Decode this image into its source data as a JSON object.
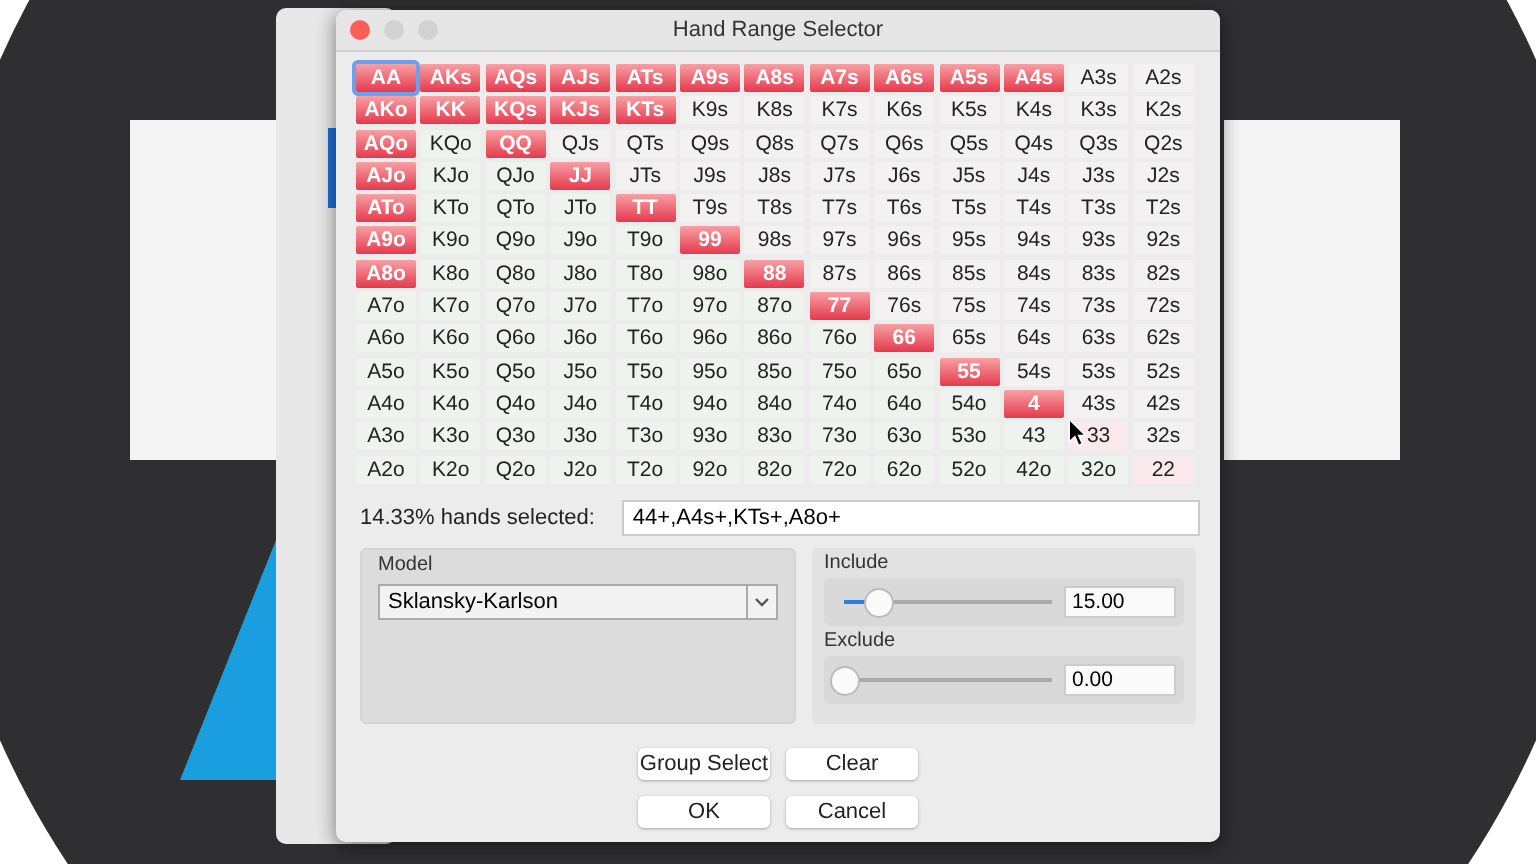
{
  "window": {
    "title": "Hand Range Selector"
  },
  "grid": [
    [
      {
        "label": "AA",
        "selected": true,
        "focused": true
      },
      {
        "label": "AKs",
        "selected": true
      },
      {
        "label": "AQs",
        "selected": true
      },
      {
        "label": "AJs",
        "selected": true
      },
      {
        "label": "ATs",
        "selected": true
      },
      {
        "label": "A9s",
        "selected": true
      },
      {
        "label": "A8s",
        "selected": true
      },
      {
        "label": "A7s",
        "selected": true
      },
      {
        "label": "A6s",
        "selected": true
      },
      {
        "label": "A5s",
        "selected": true
      },
      {
        "label": "A4s",
        "selected": true
      },
      {
        "label": "A3s",
        "selected": false
      },
      {
        "label": "A2s",
        "selected": false
      }
    ],
    [
      {
        "label": "AKo",
        "selected": true
      },
      {
        "label": "KK",
        "selected": true
      },
      {
        "label": "KQs",
        "selected": true
      },
      {
        "label": "KJs",
        "selected": true
      },
      {
        "label": "KTs",
        "selected": true
      },
      {
        "label": "K9s",
        "selected": false
      },
      {
        "label": "K8s",
        "selected": false
      },
      {
        "label": "K7s",
        "selected": false
      },
      {
        "label": "K6s",
        "selected": false
      },
      {
        "label": "K5s",
        "selected": false
      },
      {
        "label": "K4s",
        "selected": false
      },
      {
        "label": "K3s",
        "selected": false
      },
      {
        "label": "K2s",
        "selected": false
      }
    ],
    [
      {
        "label": "AQo",
        "selected": true
      },
      {
        "label": "KQo",
        "selected": false
      },
      {
        "label": "QQ",
        "selected": true
      },
      {
        "label": "QJs",
        "selected": false
      },
      {
        "label": "QTs",
        "selected": false
      },
      {
        "label": "Q9s",
        "selected": false
      },
      {
        "label": "Q8s",
        "selected": false
      },
      {
        "label": "Q7s",
        "selected": false
      },
      {
        "label": "Q6s",
        "selected": false
      },
      {
        "label": "Q5s",
        "selected": false
      },
      {
        "label": "Q4s",
        "selected": false
      },
      {
        "label": "Q3s",
        "selected": false
      },
      {
        "label": "Q2s",
        "selected": false
      }
    ],
    [
      {
        "label": "AJo",
        "selected": true
      },
      {
        "label": "KJo",
        "selected": false
      },
      {
        "label": "QJo",
        "selected": false
      },
      {
        "label": "JJ",
        "selected": true
      },
      {
        "label": "JTs",
        "selected": false
      },
      {
        "label": "J9s",
        "selected": false
      },
      {
        "label": "J8s",
        "selected": false
      },
      {
        "label": "J7s",
        "selected": false
      },
      {
        "label": "J6s",
        "selected": false
      },
      {
        "label": "J5s",
        "selected": false
      },
      {
        "label": "J4s",
        "selected": false
      },
      {
        "label": "J3s",
        "selected": false
      },
      {
        "label": "J2s",
        "selected": false
      }
    ],
    [
      {
        "label": "ATo",
        "selected": true
      },
      {
        "label": "KTo",
        "selected": false
      },
      {
        "label": "QTo",
        "selected": false
      },
      {
        "label": "JTo",
        "selected": false
      },
      {
        "label": "TT",
        "selected": true
      },
      {
        "label": "T9s",
        "selected": false
      },
      {
        "label": "T8s",
        "selected": false
      },
      {
        "label": "T7s",
        "selected": false
      },
      {
        "label": "T6s",
        "selected": false
      },
      {
        "label": "T5s",
        "selected": false
      },
      {
        "label": "T4s",
        "selected": false
      },
      {
        "label": "T3s",
        "selected": false
      },
      {
        "label": "T2s",
        "selected": false
      }
    ],
    [
      {
        "label": "A9o",
        "selected": true
      },
      {
        "label": "K9o",
        "selected": false
      },
      {
        "label": "Q9o",
        "selected": false
      },
      {
        "label": "J9o",
        "selected": false
      },
      {
        "label": "T9o",
        "selected": false
      },
      {
        "label": "99",
        "selected": true
      },
      {
        "label": "98s",
        "selected": false
      },
      {
        "label": "97s",
        "selected": false
      },
      {
        "label": "96s",
        "selected": false
      },
      {
        "label": "95s",
        "selected": false
      },
      {
        "label": "94s",
        "selected": false
      },
      {
        "label": "93s",
        "selected": false
      },
      {
        "label": "92s",
        "selected": false
      }
    ],
    [
      {
        "label": "A8o",
        "selected": true
      },
      {
        "label": "K8o",
        "selected": false
      },
      {
        "label": "Q8o",
        "selected": false
      },
      {
        "label": "J8o",
        "selected": false
      },
      {
        "label": "T8o",
        "selected": false
      },
      {
        "label": "98o",
        "selected": false
      },
      {
        "label": "88",
        "selected": true
      },
      {
        "label": "87s",
        "selected": false
      },
      {
        "label": "86s",
        "selected": false
      },
      {
        "label": "85s",
        "selected": false
      },
      {
        "label": "84s",
        "selected": false
      },
      {
        "label": "83s",
        "selected": false
      },
      {
        "label": "82s",
        "selected": false
      }
    ],
    [
      {
        "label": "A7o",
        "selected": false
      },
      {
        "label": "K7o",
        "selected": false
      },
      {
        "label": "Q7o",
        "selected": false
      },
      {
        "label": "J7o",
        "selected": false
      },
      {
        "label": "T7o",
        "selected": false
      },
      {
        "label": "97o",
        "selected": false
      },
      {
        "label": "87o",
        "selected": false
      },
      {
        "label": "77",
        "selected": true
      },
      {
        "label": "76s",
        "selected": false
      },
      {
        "label": "75s",
        "selected": false
      },
      {
        "label": "74s",
        "selected": false
      },
      {
        "label": "73s",
        "selected": false
      },
      {
        "label": "72s",
        "selected": false
      }
    ],
    [
      {
        "label": "A6o",
        "selected": false
      },
      {
        "label": "K6o",
        "selected": false
      },
      {
        "label": "Q6o",
        "selected": false
      },
      {
        "label": "J6o",
        "selected": false
      },
      {
        "label": "T6o",
        "selected": false
      },
      {
        "label": "96o",
        "selected": false
      },
      {
        "label": "86o",
        "selected": false
      },
      {
        "label": "76o",
        "selected": false
      },
      {
        "label": "66",
        "selected": true
      },
      {
        "label": "65s",
        "selected": false
      },
      {
        "label": "64s",
        "selected": false
      },
      {
        "label": "63s",
        "selected": false
      },
      {
        "label": "62s",
        "selected": false
      }
    ],
    [
      {
        "label": "A5o",
        "selected": false
      },
      {
        "label": "K5o",
        "selected": false
      },
      {
        "label": "Q5o",
        "selected": false
      },
      {
        "label": "J5o",
        "selected": false
      },
      {
        "label": "T5o",
        "selected": false
      },
      {
        "label": "95o",
        "selected": false
      },
      {
        "label": "85o",
        "selected": false
      },
      {
        "label": "75o",
        "selected": false
      },
      {
        "label": "65o",
        "selected": false
      },
      {
        "label": "55",
        "selected": true
      },
      {
        "label": "54s",
        "selected": false
      },
      {
        "label": "53s",
        "selected": false
      },
      {
        "label": "52s",
        "selected": false
      }
    ],
    [
      {
        "label": "A4o",
        "selected": false
      },
      {
        "label": "K4o",
        "selected": false
      },
      {
        "label": "Q4o",
        "selected": false
      },
      {
        "label": "J4o",
        "selected": false
      },
      {
        "label": "T4o",
        "selected": false
      },
      {
        "label": "94o",
        "selected": false
      },
      {
        "label": "84o",
        "selected": false
      },
      {
        "label": "74o",
        "selected": false
      },
      {
        "label": "64o",
        "selected": false
      },
      {
        "label": "54o",
        "selected": false
      },
      {
        "label": "4",
        "selected": true
      },
      {
        "label": "43s",
        "selected": false
      },
      {
        "label": "42s",
        "selected": false
      }
    ],
    [
      {
        "label": "A3o",
        "selected": false
      },
      {
        "label": "K3o",
        "selected": false
      },
      {
        "label": "Q3o",
        "selected": false
      },
      {
        "label": "J3o",
        "selected": false
      },
      {
        "label": "T3o",
        "selected": false
      },
      {
        "label": "93o",
        "selected": false
      },
      {
        "label": "83o",
        "selected": false
      },
      {
        "label": "73o",
        "selected": false
      },
      {
        "label": "63o",
        "selected": false
      },
      {
        "label": "53o",
        "selected": false
      },
      {
        "label": "43",
        "selected": false
      },
      {
        "label": "33",
        "selected": false
      },
      {
        "label": "32s",
        "selected": false
      }
    ],
    [
      {
        "label": "A2o",
        "selected": false
      },
      {
        "label": "K2o",
        "selected": false
      },
      {
        "label": "Q2o",
        "selected": false
      },
      {
        "label": "J2o",
        "selected": false
      },
      {
        "label": "T2o",
        "selected": false
      },
      {
        "label": "92o",
        "selected": false
      },
      {
        "label": "82o",
        "selected": false
      },
      {
        "label": "72o",
        "selected": false
      },
      {
        "label": "62o",
        "selected": false
      },
      {
        "label": "52o",
        "selected": false
      },
      {
        "label": "42o",
        "selected": false
      },
      {
        "label": "32o",
        "selected": false
      },
      {
        "label": "22",
        "selected": false
      }
    ]
  ],
  "summary": {
    "label": "14.33% hands selected:",
    "value": "44+,A4s+,KTs+,A8o+"
  },
  "model": {
    "label": "Model",
    "value": "Sklansky-Karlson"
  },
  "sliders": [
    {
      "label": "Include",
      "level": 0.16,
      "value": "15.00"
    },
    {
      "label": "Exclude",
      "level": 0,
      "value": "0.00"
    }
  ],
  "buttons": [
    [
      "Group Select",
      "Clear"
    ],
    [
      "OK",
      "Cancel"
    ]
  ]
}
